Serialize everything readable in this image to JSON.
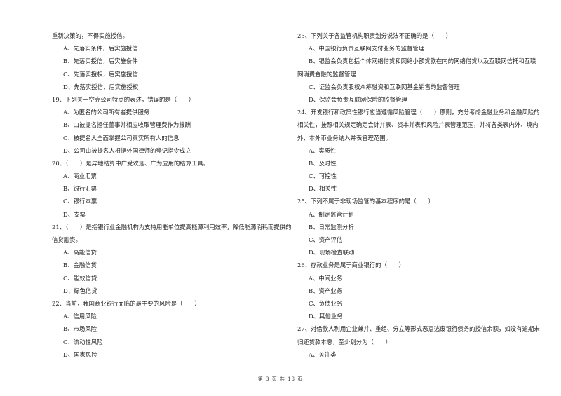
{
  "left_column": {
    "continuation": "重新决策的，不得实施授信。",
    "continuation_options": [
      "A、先落实条件，后实施授信",
      "B、先落实授信，后实施条件",
      "C、先落实授权，后实施授信",
      "D、先落实授信，后实施授权"
    ],
    "questions": [
      {
        "number": "19",
        "stem_lines": [
          "19、下列关于空壳公司特点的表述，错误的是（　　）"
        ],
        "options": [
          "A、为匿名的公司所有者提供服务",
          "B、由被提名担任董事并相应收取管理费作为报酬",
          "C、被提名人全面掌握公司真实所有人的信息",
          "D、公司由被提名人根据外国律师的登记指令成立"
        ]
      },
      {
        "number": "20",
        "stem_lines": [
          "20、（　　）是异地结算中广受欢迎、广为应用的结算工具。"
        ],
        "options": [
          "A、商业汇票",
          "B、银行汇票",
          "C、银行本票",
          "D、支票"
        ]
      },
      {
        "number": "21",
        "stem_lines": [
          "21、（　　）是指银行业金融机构为支持用能单位提高能源利用效率，降低能源消耗而提供的",
          "信贷融资。"
        ],
        "options": [
          "A、高能信贷",
          "B、金融信贷",
          "C、能效信贷",
          "D、绿色信贷"
        ]
      },
      {
        "number": "22",
        "stem_lines": [
          "22、当前，我国商业银行面临的最主要的风险是（　　）"
        ],
        "options": [
          "A、信用风险",
          "B、市场风险",
          "C、流动性风险",
          "D、国家风险"
        ]
      }
    ]
  },
  "right_column": {
    "questions": [
      {
        "number": "23",
        "stem_lines": [
          "23、下列关于各监管机构职责划分说法不正确的是（　　）"
        ],
        "options_lines": [
          {
            "text": "A、中国银行负责互联网支付业务的监督管理",
            "indent": true
          },
          {
            "text": "B、银监会负责包括个体网络借贷和网络小额贷款在内的网络借贷以及互联网信托和互联",
            "indent": true
          },
          {
            "text": "网消费金融的监督管理",
            "indent": false
          },
          {
            "text": "C、证监会负责股权众筹融资和互联网基金销售的监督管理",
            "indent": true
          },
          {
            "text": "D、保监会负责互联网保险的监督管理",
            "indent": true
          }
        ]
      },
      {
        "number": "24",
        "stem_lines": [
          "24、开发银行和政策性银行应当遵循风险管理（　　）原则，充分考虑金融业务和金融风险的",
          "相关性，按照相关规定确定会计并表、资本并表和风险并表管理范围，并将各类表内外、境内",
          "外、本外币业务纳入并表管理范围。"
        ],
        "options_lines": [
          {
            "text": "A、实质性",
            "indent": true
          },
          {
            "text": "B、及时性",
            "indent": true
          },
          {
            "text": "C、可控性",
            "indent": true
          },
          {
            "text": "D、相关性",
            "indent": true
          }
        ]
      },
      {
        "number": "25",
        "stem_lines": [
          "25、下列不属于非现场监管的基本程序的是（　　）"
        ],
        "options_lines": [
          {
            "text": "A、制定监管计划",
            "indent": true
          },
          {
            "text": "B、日常监测分析",
            "indent": true
          },
          {
            "text": "C、资产评估",
            "indent": true
          },
          {
            "text": "D、现场检查联动",
            "indent": true
          }
        ]
      },
      {
        "number": "26",
        "stem_lines": [
          "26、存款业务是属于商业银行的（　　）"
        ],
        "options_lines": [
          {
            "text": "A、中间业务",
            "indent": true
          },
          {
            "text": "B、资产业务",
            "indent": true
          },
          {
            "text": "C、负债业务",
            "indent": true
          },
          {
            "text": "D、其他业务",
            "indent": true
          }
        ]
      },
      {
        "number": "27",
        "stem_lines": [
          "27、对借款人利用企业兼并、重组、分立等形式恶意逃废银行债务的授信余额，如没有逾期未",
          "归还贷款本息，至少划分为（　　）"
        ],
        "options_lines": [
          {
            "text": "A、关注类",
            "indent": true
          }
        ]
      }
    ]
  },
  "footer": {
    "page_label": "第 3 页 共 18 页"
  }
}
